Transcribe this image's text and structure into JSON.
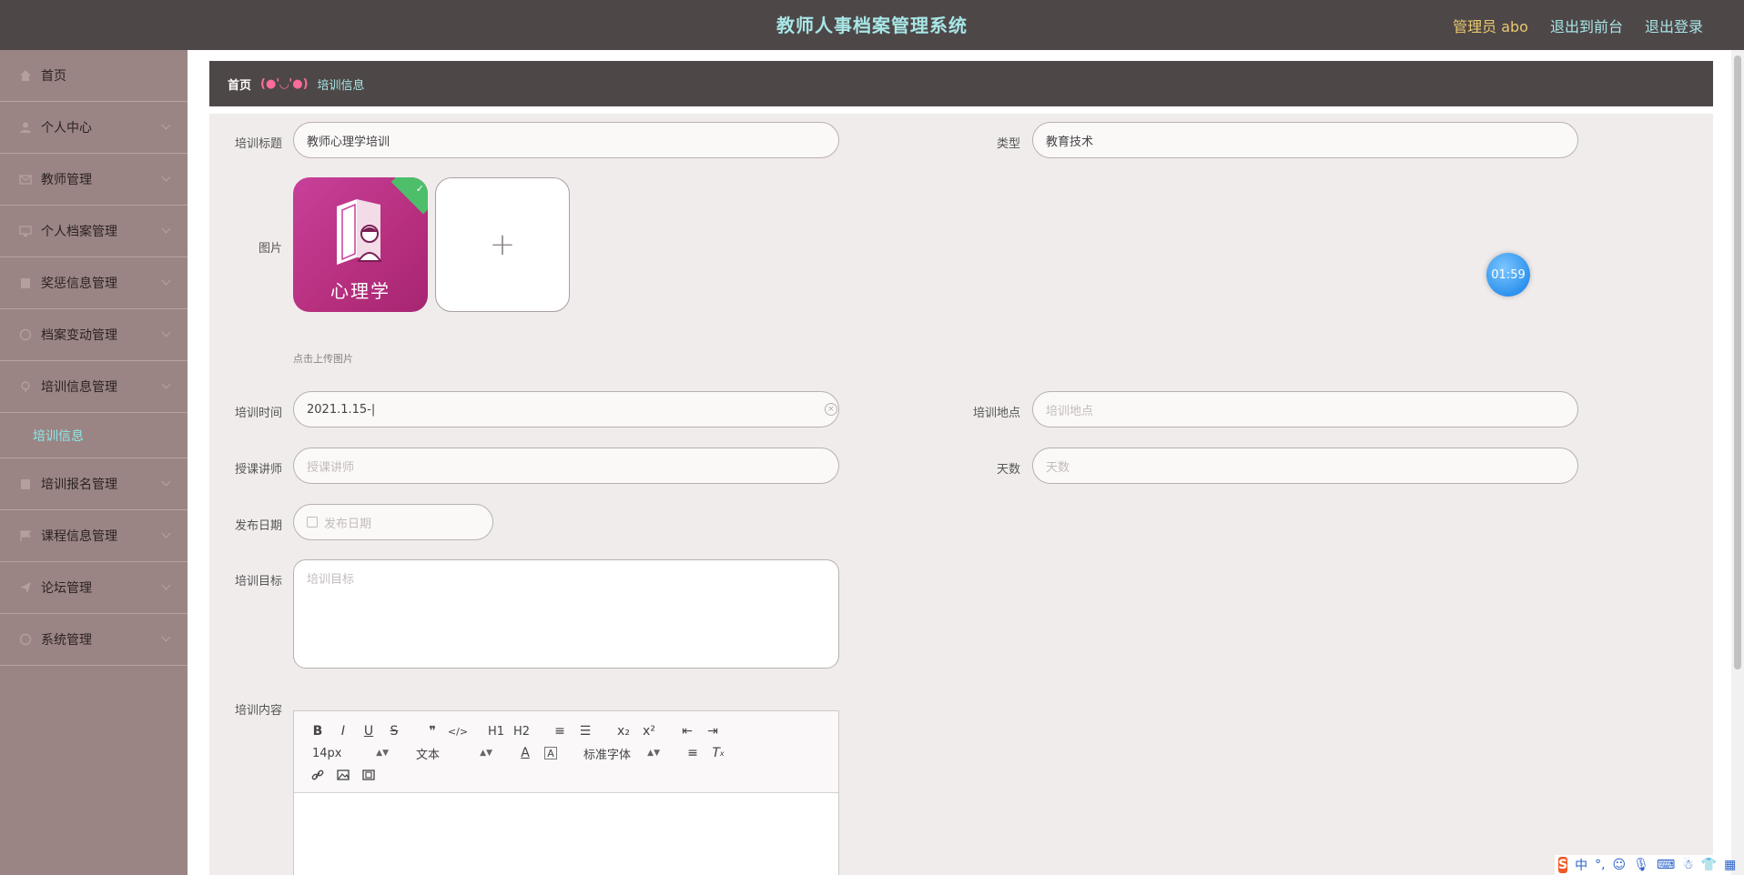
{
  "header": {
    "title": "教师人事档案管理系统",
    "admin_label": "管理员 abo",
    "to_front": "退出到前台",
    "logout": "退出登录"
  },
  "sidebar": {
    "items": [
      {
        "label": "首页",
        "icon": "home-icon"
      },
      {
        "label": "个人中心",
        "icon": "user-icon"
      },
      {
        "label": "教师管理",
        "icon": "mail-icon"
      },
      {
        "label": "个人档案管理",
        "icon": "monitor-icon"
      },
      {
        "label": "奖惩信息管理",
        "icon": "building-icon"
      },
      {
        "label": "档案变动管理",
        "icon": "circle-icon"
      },
      {
        "label": "培训信息管理",
        "icon": "pin-icon"
      },
      {
        "label": "培训报名管理",
        "icon": "building-icon"
      },
      {
        "label": "课程信息管理",
        "icon": "flag-icon"
      },
      {
        "label": "论坛管理",
        "icon": "send-icon"
      },
      {
        "label": "系统管理",
        "icon": "circle-icon"
      }
    ],
    "active_sub": "培训信息"
  },
  "breadcrumb": {
    "home": "首页",
    "separator": "(●'◡'●)",
    "current": "培训信息"
  },
  "form": {
    "title_label": "培训标题",
    "title_value": "教师心理学培训",
    "type_label": "类型",
    "type_value": "教育技术",
    "image_label": "图片",
    "image_caption": "心理学",
    "upload_hint": "点击上传图片",
    "time_label": "培训时间",
    "time_value": "2021.1.15-|",
    "location_label": "培训地点",
    "location_placeholder": "培训地点",
    "lecturer_label": "授课讲师",
    "lecturer_placeholder": "授课讲师",
    "days_label": "天数",
    "days_placeholder": "天数",
    "date_label": "发布日期",
    "date_placeholder": "发布日期",
    "goal_label": "培训目标",
    "goal_placeholder": "培训目标",
    "content_label": "培训内容"
  },
  "editor": {
    "row1": [
      "B",
      "I",
      "U",
      "S",
      "❞",
      "</>",
      "H1",
      "H2",
      "≡",
      "☰",
      "x₂",
      "x²",
      "⇤",
      "⇥"
    ],
    "font_size": "14px",
    "text_type": "文本",
    "font_family": "标准字体"
  },
  "timer": "01:59",
  "ime": {
    "lang": "中",
    "punct": "°,"
  }
}
